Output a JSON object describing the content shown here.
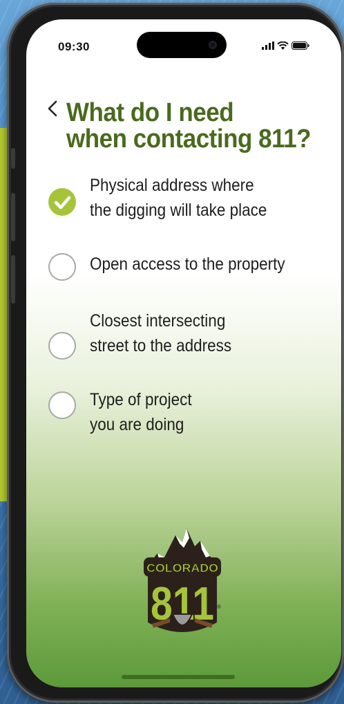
{
  "status_bar": {
    "time": "09:30"
  },
  "header": {
    "back_icon": "chevron-left-icon",
    "title_line1": "What do I need",
    "title_line2": "when contacting 811?"
  },
  "checklist": {
    "items": [
      {
        "line1": "Physical address where",
        "line2": "the digging will take place",
        "checked": true
      },
      {
        "line1": "Open access to the property",
        "line2": "",
        "checked": false
      },
      {
        "line1": "Closest intersecting",
        "line2": "street to the address",
        "checked": false
      },
      {
        "line1": "Type of project",
        "line2": "you are doing",
        "checked": false
      }
    ]
  },
  "logo": {
    "word": "COLORADO",
    "number": "811",
    "mark": "®"
  },
  "colors": {
    "title": "#4a6a1e",
    "check": "#a6c43a",
    "logo_green": "#a6c43a",
    "logo_dark": "#3a2a1c"
  }
}
